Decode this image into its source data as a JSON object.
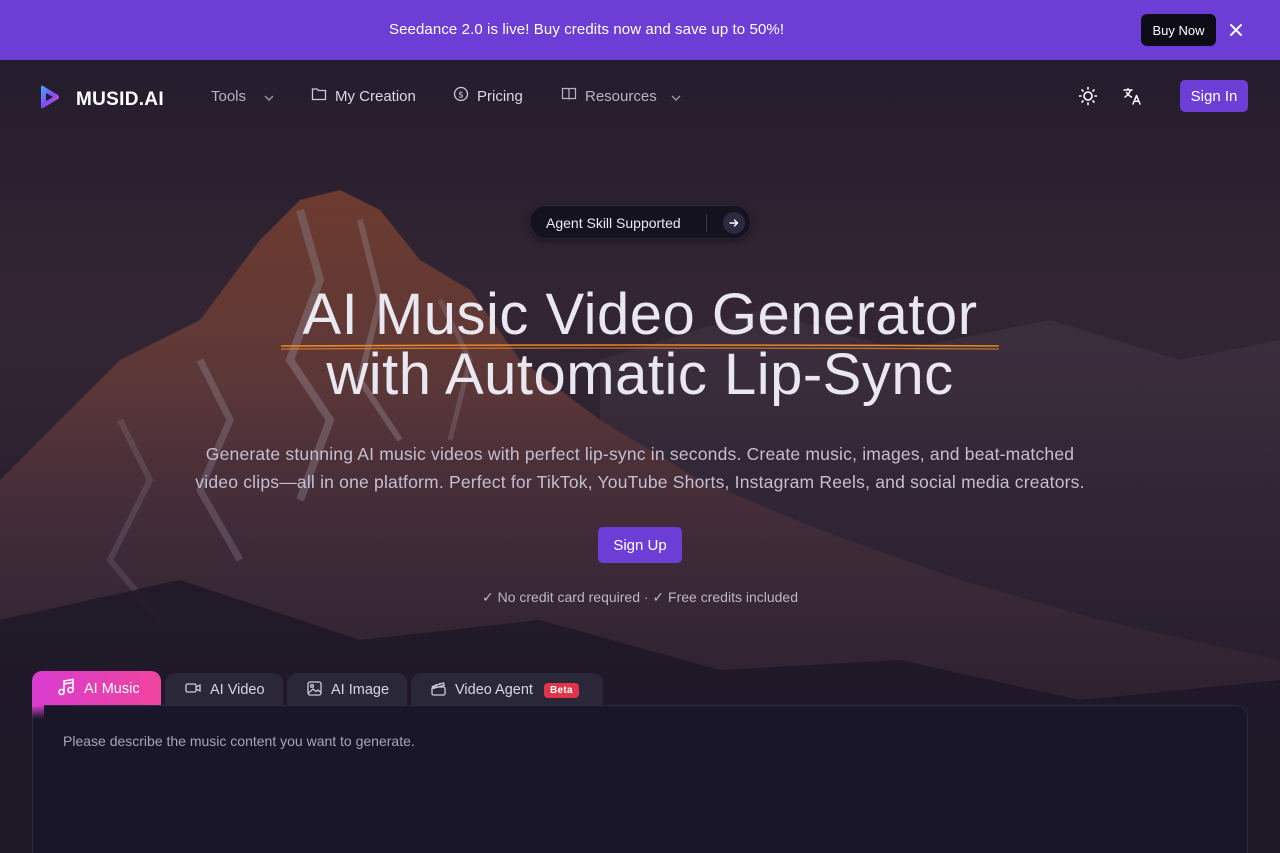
{
  "promo": {
    "text": "Seedance 2.0 is live! Buy credits now and save up to 50%!",
    "button_label": "Buy Now",
    "close_icon": "close-icon"
  },
  "nav": {
    "logo_text": "MUSID.AI",
    "items": [
      {
        "label": "Tools",
        "icon": "chevron-down-icon"
      },
      {
        "label": "My Creation",
        "icon": "folder-icon"
      },
      {
        "label": "Pricing",
        "icon": "dollar-circle-icon"
      },
      {
        "label": "Resources",
        "icon": "book-icon"
      }
    ],
    "theme_icon": "sun-icon",
    "language_icon": "translate-icon",
    "sign_in_label": "Sign In"
  },
  "hero": {
    "pill_label": "Agent Skill Supported",
    "title_line1": "AI Music Video Generator",
    "title_line2": "with Automatic Lip-Sync",
    "subtitle_line1": "Generate stunning AI music videos with perfect lip-sync in seconds. Create music, images, and beat-matched",
    "subtitle_line2": "video clips—all in one platform. Perfect for TikTok, YouTube Shorts, Instagram Reels, and social media creators.",
    "cta_label": "Sign Up",
    "fine_print": "✓ No credit card required · ✓ Free credits included"
  },
  "tabs": [
    {
      "label": "AI Music",
      "icon": "music-note-icon",
      "active": true
    },
    {
      "label": "AI Video",
      "icon": "video-camera-icon",
      "active": false
    },
    {
      "label": "AI Image",
      "icon": "image-icon",
      "active": false
    },
    {
      "label": "Video Agent",
      "icon": "clapperboard-icon",
      "active": false,
      "badge": "Beta"
    }
  ],
  "composer": {
    "placeholder": "Please describe the music content you want to generate."
  },
  "colors": {
    "brand_purple": "#6d3ed6",
    "tab_active_from": "#d93ccf",
    "tab_active_to": "#f0449f",
    "title_underline": "#e8862a",
    "beta_badge": "#e0344a"
  }
}
